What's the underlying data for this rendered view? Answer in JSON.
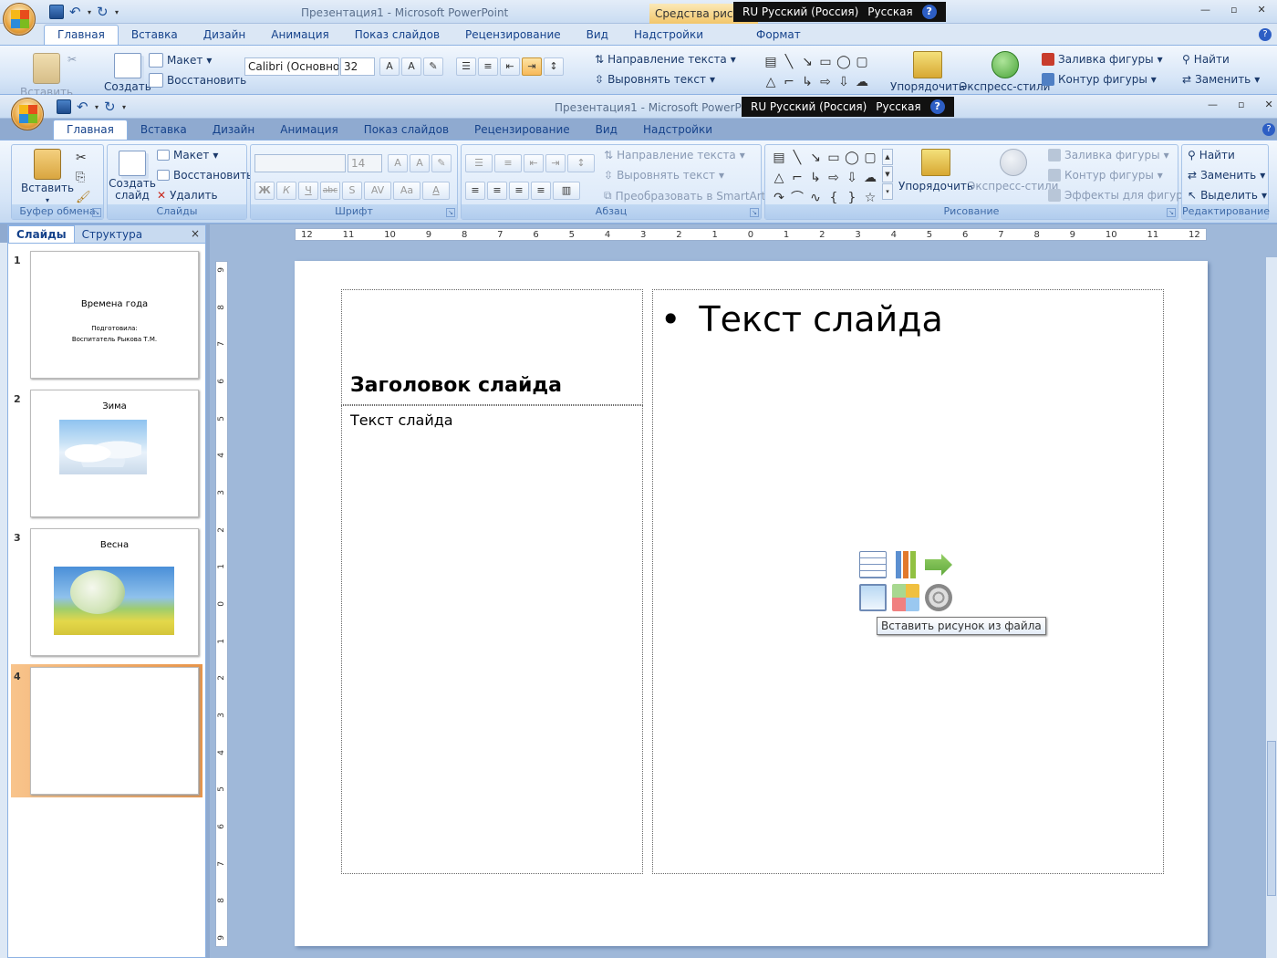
{
  "back_window": {
    "title": "Презентация1 - Microsoft PowerPoint",
    "context_tab": "Средства рисова",
    "langbar": {
      "lang": "RU Русский (Россия)",
      "layout": "Русская",
      "help": "?"
    },
    "tabs": [
      "Главная",
      "Вставка",
      "Дизайн",
      "Анимация",
      "Показ слайдов",
      "Рецензирование",
      "Вид",
      "Надстройки",
      "Формат"
    ],
    "ribbon": {
      "paste": "Вставить",
      "new_slide": "Создать",
      "layout": "Макет",
      "restore": "Восстановить",
      "font": "Calibri (Основно",
      "size": "32",
      "text_direction": "Направление текста",
      "align_text": "Выровнять текст",
      "arrange": "Упорядочить",
      "quick_styles": "Экспресс-стили",
      "fill": "Заливка фигуры",
      "outline": "Контур фигуры",
      "find": "Найти",
      "replace": "Заменить"
    }
  },
  "window": {
    "title": "Презентация1 - Microsoft PowerPoint",
    "langbar": {
      "lang": "RU Русский (Россия)",
      "layout": "Русская",
      "help": "?"
    },
    "tabs": [
      "Главная",
      "Вставка",
      "Дизайн",
      "Анимация",
      "Показ слайдов",
      "Рецензирование",
      "Вид",
      "Надстройки"
    ],
    "ribbon": {
      "clipboard": {
        "label": "Буфер обмена",
        "paste": "Вставить"
      },
      "slides": {
        "label": "Слайды",
        "new_slide": "Создать слайд",
        "layout": "Макет",
        "restore": "Восстановить",
        "delete": "Удалить"
      },
      "font": {
        "label": "Шрифт",
        "font": "",
        "size": "14",
        "bold": "Ж",
        "italic": "К",
        "underline": "Ч",
        "strike": "abc",
        "shadow": "S",
        "spacing": "AV",
        "case": "Aa",
        "color": "A"
      },
      "paragraph": {
        "label": "Абзац",
        "text_direction": "Направление текста",
        "align_text": "Выровнять текст",
        "smartart": "Преобразовать в SmartArt"
      },
      "drawing": {
        "label": "Рисование",
        "arrange": "Упорядочить",
        "quick_styles": "Экспресс-стили",
        "fill": "Заливка фигуры",
        "outline": "Контур фигуры",
        "effects": "Эффекты для фигур"
      },
      "editing": {
        "label": "Редактирование",
        "find": "Найти",
        "replace": "Заменить",
        "select": "Выделить"
      }
    }
  },
  "slides_panel": {
    "tabs": [
      "Слайды",
      "Структура"
    ],
    "close": "×",
    "slides": [
      {
        "num": "1",
        "title": "Времена года",
        "subtitle_1": "Подготовила:",
        "subtitle_2": "Воспитатель Рыкова Т.М."
      },
      {
        "num": "2",
        "title": "Зима"
      },
      {
        "num": "3",
        "title": "Весна"
      },
      {
        "num": "4",
        "title": ""
      }
    ]
  },
  "ruler": {
    "h": [
      "12",
      "11",
      "10",
      "9",
      "8",
      "7",
      "6",
      "5",
      "4",
      "3",
      "2",
      "1",
      "0",
      "1",
      "2",
      "3",
      "4",
      "5",
      "6",
      "7",
      "8",
      "9",
      "10",
      "11",
      "12"
    ],
    "v": [
      "9",
      "8",
      "7",
      "6",
      "5",
      "4",
      "3",
      "2",
      "1",
      "0",
      "1",
      "2",
      "3",
      "4",
      "5",
      "6",
      "7",
      "8",
      "9"
    ]
  },
  "slide": {
    "title": "Заголовок слайда",
    "left_text": "Текст слайда",
    "right_bullet": "•",
    "right_text": "Текст слайда",
    "tooltip": "Вставить рисунок из файла"
  }
}
